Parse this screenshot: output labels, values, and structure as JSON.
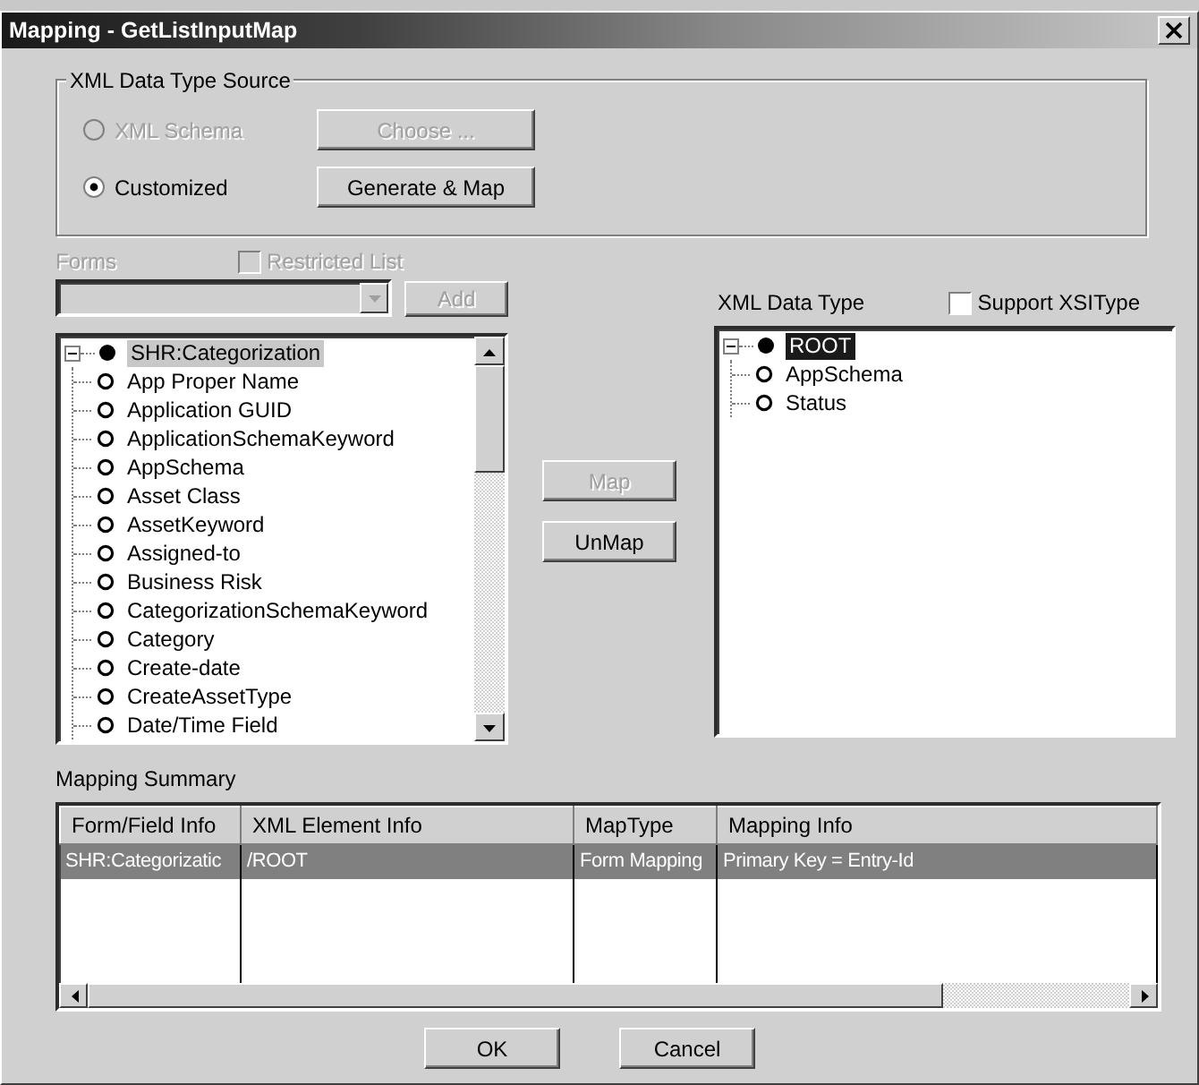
{
  "window": {
    "title": "Mapping - GetListInputMap"
  },
  "source_group": {
    "title": "XML Data Type Source",
    "options": [
      {
        "label": "XML Schema",
        "selected": false,
        "disabled": true,
        "button": {
          "label": "Choose ...",
          "disabled": true
        }
      },
      {
        "label": "Customized",
        "selected": true,
        "disabled": false,
        "button": {
          "label": "Generate & Map",
          "disabled": false
        }
      }
    ]
  },
  "forms": {
    "label": "Forms",
    "disabled": true,
    "restricted": {
      "label": "Restricted List",
      "checked": false,
      "disabled": true
    },
    "add_button": {
      "label": "Add",
      "disabled": true
    }
  },
  "form_tree": {
    "focused": false,
    "root": {
      "label": "SHR:Categorization",
      "selected": true,
      "expanded": true,
      "children": [
        {
          "label": "App Proper Name",
          "selected": false
        },
        {
          "label": "Application GUID",
          "selected": false
        },
        {
          "label": "ApplicationSchemaKeyword",
          "selected": false
        },
        {
          "label": "AppSchema",
          "selected": false
        },
        {
          "label": "Asset Class",
          "selected": false
        },
        {
          "label": "AssetKeyword",
          "selected": false
        },
        {
          "label": "Assigned-to",
          "selected": false
        },
        {
          "label": "Business Risk",
          "selected": false
        },
        {
          "label": "CategorizationSchemaKeyword",
          "selected": false
        },
        {
          "label": "Category",
          "selected": false
        },
        {
          "label": "Create-date",
          "selected": false
        },
        {
          "label": "CreateAssetType",
          "selected": false
        },
        {
          "label": "Date/Time Field",
          "selected": false
        }
      ]
    }
  },
  "map_buttons": [
    {
      "label": "Map",
      "disabled": true
    },
    {
      "label": "UnMap",
      "disabled": false
    }
  ],
  "xml_panel": {
    "label": "XML Data Type",
    "support_xsi": {
      "label": "Support XSIType",
      "checked": false,
      "disabled": false
    }
  },
  "xml_tree": {
    "focused": true,
    "root": {
      "label": "ROOT",
      "selected": true,
      "expanded": true,
      "children": [
        {
          "label": "AppSchema",
          "selected": false
        },
        {
          "label": "Status",
          "selected": false
        }
      ]
    }
  },
  "summary": {
    "label": "Mapping Summary",
    "columns": [
      "Form/Field Info",
      "XML Element Info",
      "MapType",
      "Mapping Info"
    ],
    "rows": [
      {
        "cells": [
          "SHR:Categorizatic",
          "/ROOT",
          "Form Mapping",
          "Primary Key = Entry-Id"
        ],
        "selected": true
      }
    ]
  },
  "buttons": [
    {
      "label": "OK"
    },
    {
      "label": "Cancel"
    }
  ]
}
